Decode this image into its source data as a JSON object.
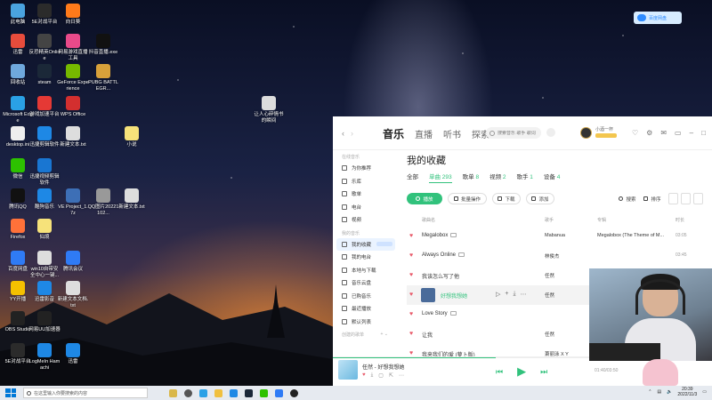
{
  "desktop": {
    "icons": [
      {
        "label": "此电脑",
        "color": "#4aa3df"
      },
      {
        "label": "5E对战平台",
        "color": "#2b2b2b"
      },
      {
        "label": "向日葵",
        "color": "#ff7a1a"
      },
      {
        "label": "迅雷",
        "color": "#e74c3c"
      },
      {
        "label": "反恐精英Online",
        "color": "#444"
      },
      {
        "label": "网易游戏直播工具",
        "color": "#e94a8a"
      },
      {
        "label": "抖音直播.exe",
        "color": "#111"
      },
      {
        "label": "回收站",
        "color": "#6fa8dc"
      },
      {
        "label": "steam",
        "color": "#1b2838"
      },
      {
        "label": "GeForce Experience",
        "color": "#76b900"
      },
      {
        "label": "PUBG BATTLEGR...",
        "color": "#d8a13a"
      },
      {
        "label": "Microsoft Edge",
        "color": "#2aa1e6"
      },
      {
        "label": "游戏加速平台",
        "color": "#e53935"
      },
      {
        "label": "WPS Office",
        "color": "#d32f2f"
      },
      {
        "label": "desktop.ini",
        "color": "#eee"
      },
      {
        "label": "迅捷剪辑软件",
        "color": "#1e88e5"
      },
      {
        "label": "新建文本.txt",
        "color": "#ddd"
      },
      {
        "label": "小说",
        "color": "#f6e27a"
      },
      {
        "label": "微信",
        "color": "#2dc100"
      },
      {
        "label": "迅捷视频剪辑软件",
        "color": "#1976d2"
      },
      {
        "label": "腾讯QQ",
        "color": "#111"
      },
      {
        "label": "酷狗音乐",
        "color": "#1e88e5"
      },
      {
        "label": "VE Project_1.7z",
        "color": "#3d6fb6"
      },
      {
        "label": "QQ图片20221102...",
        "color": "#999"
      },
      {
        "label": "新建文本.txt",
        "color": "#ddd"
      },
      {
        "label": "Firefox",
        "color": "#ff7139"
      },
      {
        "label": "仙境",
        "color": "#f6e27a"
      },
      {
        "label": "百度网盘",
        "color": "#2f7bf5"
      },
      {
        "label": "win10自带安全中心一键...",
        "color": "#ddd"
      },
      {
        "label": "腾讯会议",
        "color": "#2f7bf5"
      },
      {
        "label": "YY开播",
        "color": "#f5c000"
      },
      {
        "label": "迅雷影音",
        "color": "#1e88e5"
      },
      {
        "label": "新建文本文档.txt",
        "color": "#ddd"
      },
      {
        "label": "OBS Studio",
        "color": "#222"
      },
      {
        "label": "网易UU加速器",
        "color": "#222"
      },
      {
        "label": "5E对战平台",
        "color": "#2b2b2b"
      },
      {
        "label": "LogMeIn Hamachi",
        "color": "#1e88e5"
      },
      {
        "label": "迅雷",
        "color": "#1e88e5"
      },
      {
        "label": "让人心碎情书的瞬间",
        "color": "#ddd"
      }
    ]
  },
  "cloud_widget": {
    "text": "百度网盘"
  },
  "app": {
    "nav": {
      "back": "‹",
      "forward": "›"
    },
    "top_tabs": [
      "音乐",
      "直播",
      "听书",
      "探索"
    ],
    "search_placeholder": "搜索音乐 歌手 歌词",
    "user_name": "小酒一杯",
    "sidebar": {
      "section1": "在线音乐",
      "items1": [
        "为你推荐",
        "乐库",
        "歌单",
        "电台",
        "视频"
      ],
      "section2": "我的音乐",
      "items2": [
        "我的收藏",
        "我的电台",
        "本地与下载",
        "音乐云盘",
        "已购音乐",
        "最近播放",
        "默认列表"
      ],
      "section3": "创建的歌单"
    },
    "main": {
      "title": "我的收藏",
      "tabs": [
        {
          "label": "全部",
          "count": ""
        },
        {
          "label": "单曲",
          "count": "293"
        },
        {
          "label": "歌单",
          "count": "8"
        },
        {
          "label": "视频",
          "count": "2"
        },
        {
          "label": "歌手",
          "count": "1"
        },
        {
          "label": "设备",
          "count": "4"
        }
      ],
      "buttons": {
        "play": "播放",
        "batch": "批量操作",
        "download": "下载",
        "add": "添加",
        "search": "搜索",
        "sort": "排序"
      },
      "columns": {
        "title": "歌曲名",
        "artist": "歌手",
        "album": "专辑",
        "duration": "时长"
      },
      "songs": [
        {
          "title": "Megalobox",
          "artist": "Mabanua",
          "album": "Megalobox (The Theme of M...",
          "duration": "03:05"
        },
        {
          "title": "Always Online",
          "artist": "林俊杰",
          "album": "",
          "duration": "03:45"
        },
        {
          "title": "我该怎么写了他",
          "artist": "任然",
          "album": "",
          "duration": ""
        },
        {
          "title": "好想我想她",
          "artist": "任然",
          "album": "",
          "duration": ""
        },
        {
          "title": "Love Story",
          "artist": "",
          "album": "",
          "duration": ""
        },
        {
          "title": "让我",
          "artist": "任然",
          "album": "",
          "duration": ""
        },
        {
          "title": "我来我们的爱 (萝卜版)",
          "artist": "萧丽泳 X Y",
          "album": "",
          "duration": ""
        }
      ]
    },
    "player": {
      "now_playing": "任然 - 好想我想她",
      "time": "01:40/03:50",
      "progress": 0.43
    }
  },
  "taskbar": {
    "search_placeholder": "在这里输入你要搜索的内容",
    "time": "20:39",
    "date": "2022/11/3"
  }
}
